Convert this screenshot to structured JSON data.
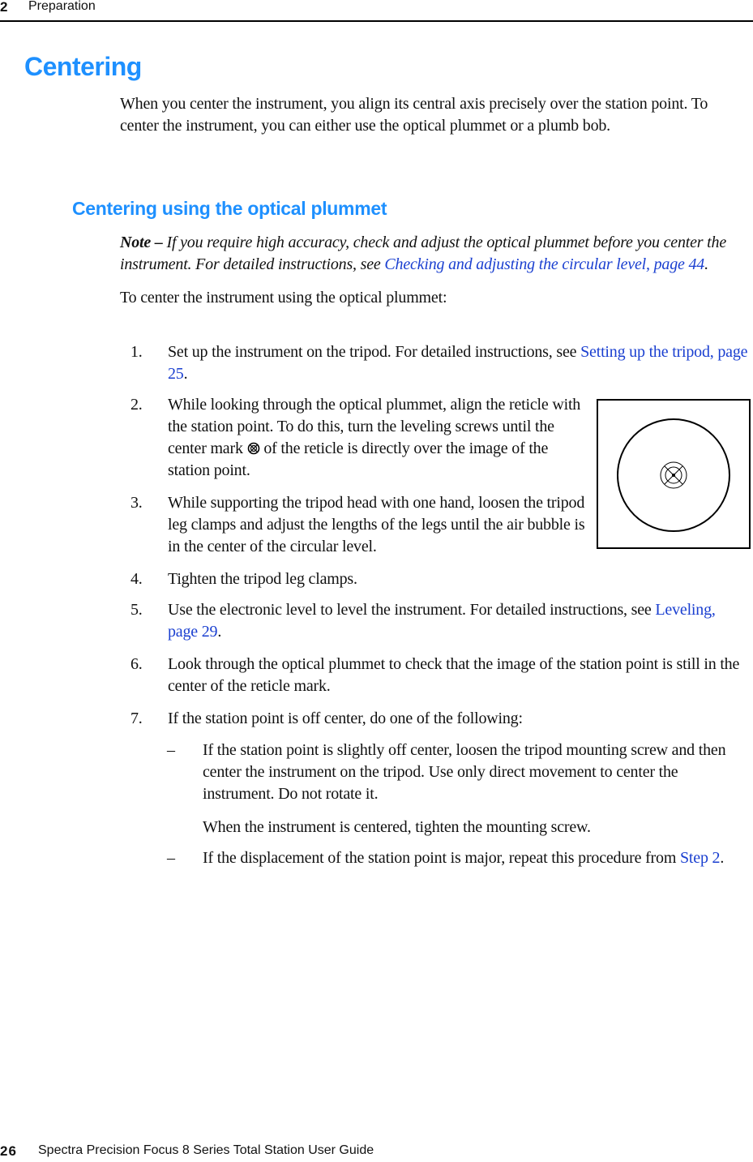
{
  "header": {
    "chapter_number": "2",
    "chapter_title": "Preparation"
  },
  "section": {
    "title": "Centering",
    "intro": "When you center the instrument, you align its central axis precisely over the station point. To center the instrument, you can either use the optical plummet or a plumb bob."
  },
  "subsection": {
    "title": "Centering using the optical plummet",
    "note": {
      "label": "Note –",
      "text": " If you require high accuracy, check and adjust the optical plummet before you center the instrument. For detailed instructions, see ",
      "link": "Checking and adjusting the circular level, page 44",
      "after": "."
    },
    "lead": "To center the instrument using the optical plummet:",
    "steps": [
      {
        "num": "1.",
        "text": "Set up the instrument on the tripod. For detailed instructions, see ",
        "link": "Setting up the tripod, page 25",
        "after": "."
      },
      {
        "num": "2.",
        "text_before": "While looking through the optical plummet, align the reticle with the station point. To do this, turn the leveling screws until the center mark ",
        "text_after": " of the reticle is directly over the image of the station point.",
        "icon": "reticle-center-mark-icon"
      },
      {
        "num": "3.",
        "text": "While supporting the tripod head with one hand, loosen the tripod leg clamps and adjust the lengths of the legs until the air bubble is in the center of the circular level."
      },
      {
        "num": "4.",
        "text": "Tighten the tripod leg clamps."
      },
      {
        "num": "5.",
        "text": "Use the electronic level to level the instrument. For detailed instructions, see ",
        "link": "Leveling, page 29",
        "after": "."
      },
      {
        "num": "6.",
        "text": "Look through the optical plummet to check that the image of the station point is still in the center of the reticle mark."
      },
      {
        "num": "7.",
        "text": "If the station point is off center, do one of the following:"
      }
    ],
    "sub_steps": [
      {
        "dash": "–",
        "text": "If the station point is slightly off center, loosen the tripod mounting screw and then center the instrument on the tripod. Use only direct movement to center the instrument. Do not rotate it.",
        "followup": "When the instrument is centered, tighten the mounting screw."
      },
      {
        "dash": "–",
        "text": "If the displacement of the station point is major, repeat this procedure from ",
        "link": "Step 2",
        "after": "."
      }
    ],
    "figure": {
      "name": "optical-plummet-reticle-illustration",
      "colors": {
        "stroke": "#000000",
        "background": "#ffffff"
      }
    }
  },
  "footer": {
    "page_number": "26",
    "guide_title": "Spectra Precision Focus 8 Series Total Station User Guide"
  },
  "colors": {
    "heading": "#1e90ff",
    "link": "#1a3fd0",
    "text": "#111111"
  }
}
